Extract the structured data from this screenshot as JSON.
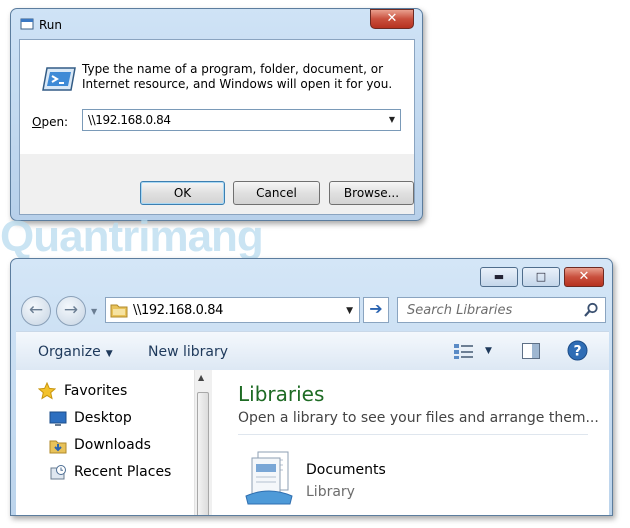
{
  "run_dialog": {
    "title": "Run",
    "description": "Type the name of a program, folder, document, or Internet resource, and Windows will open it for you.",
    "open_label_prefix": "O",
    "open_label_rest": "pen:",
    "open_value": "\\\\192.168.0.84",
    "close_glyph": "✕",
    "buttons": {
      "ok": "OK",
      "cancel": "Cancel",
      "browse": "Browse..."
    }
  },
  "watermark": "Quantrimang",
  "explorer": {
    "caption_buttons": {
      "minimize": "▬",
      "maximize": "□",
      "close": "✕"
    },
    "back_glyph": "←",
    "forward_glyph": "→",
    "address_value": "\\\\192.168.0.84",
    "search_placeholder": "Search Libraries",
    "commands": {
      "organize": "Organize",
      "new_library": "New library"
    },
    "nav": {
      "favorites": "Favorites",
      "items": [
        "Desktop",
        "Downloads",
        "Recent Places"
      ]
    },
    "content": {
      "title": "Libraries",
      "subtitle": "Open a library to see your files and arrange them...",
      "items": [
        {
          "name": "Documents",
          "type": "Library"
        }
      ]
    }
  },
  "colors": {
    "library_title": "#1e6b24",
    "command_text": "#1e395b",
    "close_red": "#c9503d"
  }
}
